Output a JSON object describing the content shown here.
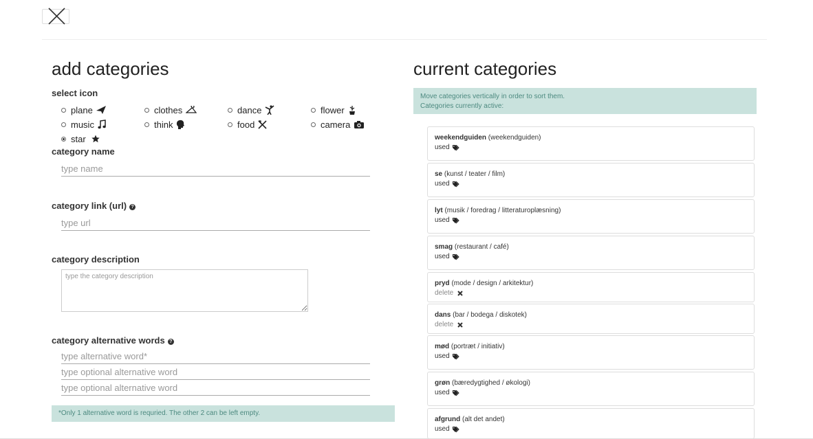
{
  "left": {
    "title": "add categories",
    "select_icon_label": "select icon",
    "icons": [
      {
        "label": "plane",
        "icon": "plane-icon",
        "checked": false
      },
      {
        "label": "clothes",
        "icon": "hanger-icon",
        "checked": false
      },
      {
        "label": "dance",
        "icon": "dancer-icon",
        "checked": false
      },
      {
        "label": "flower",
        "icon": "flower-icon",
        "checked": false
      },
      {
        "label": "music",
        "icon": "music-note-icon",
        "checked": false
      },
      {
        "label": "think",
        "icon": "head-icon",
        "checked": false
      },
      {
        "label": "food",
        "icon": "cutlery-icon",
        "checked": false
      },
      {
        "label": "camera",
        "icon": "camera-icon",
        "checked": false
      },
      {
        "label": "star",
        "icon": "star-icon",
        "checked": true
      }
    ],
    "name_label": "category name",
    "name_placeholder": "type name",
    "link_label": "category link (url)",
    "link_placeholder": "type url",
    "description_label": "category description",
    "description_placeholder": "type the category description",
    "alt_label": "category alternative words",
    "alt_placeholders": [
      "type alternative word*",
      "type optional alternative word",
      "type optional alternative word"
    ],
    "alt_note": "*Only 1 alternative word is requried. The other 2 can be left empty."
  },
  "right": {
    "title": "current categories",
    "info_line1": "Move categories vertically in order to sort them.",
    "info_line2": "Categories currently active:",
    "categories": [
      {
        "name": "weekendguiden",
        "desc": "(weekendguiden)",
        "status": "used"
      },
      {
        "name": "se",
        "desc": "(kunst / teater / film)",
        "status": "used"
      },
      {
        "name": "lyt",
        "desc": "(musik / foredrag / litteraturoplæsning)",
        "status": "used"
      },
      {
        "name": "smag",
        "desc": "(restaurant / café)",
        "status": "used"
      },
      {
        "name": "pryd",
        "desc": "(mode / design / arkitektur)",
        "status": "delete"
      },
      {
        "name": "dans",
        "desc": "(bar / bodega / diskotek)",
        "status": "delete"
      },
      {
        "name": "mød",
        "desc": "(portræt / initiativ)",
        "status": "used"
      },
      {
        "name": "grøn",
        "desc": "(bæredygtighed / økologi)",
        "status": "used"
      },
      {
        "name": "afgrund",
        "desc": "(alt det andet)",
        "status": "used"
      }
    ]
  },
  "info_icon_glyph": "?"
}
